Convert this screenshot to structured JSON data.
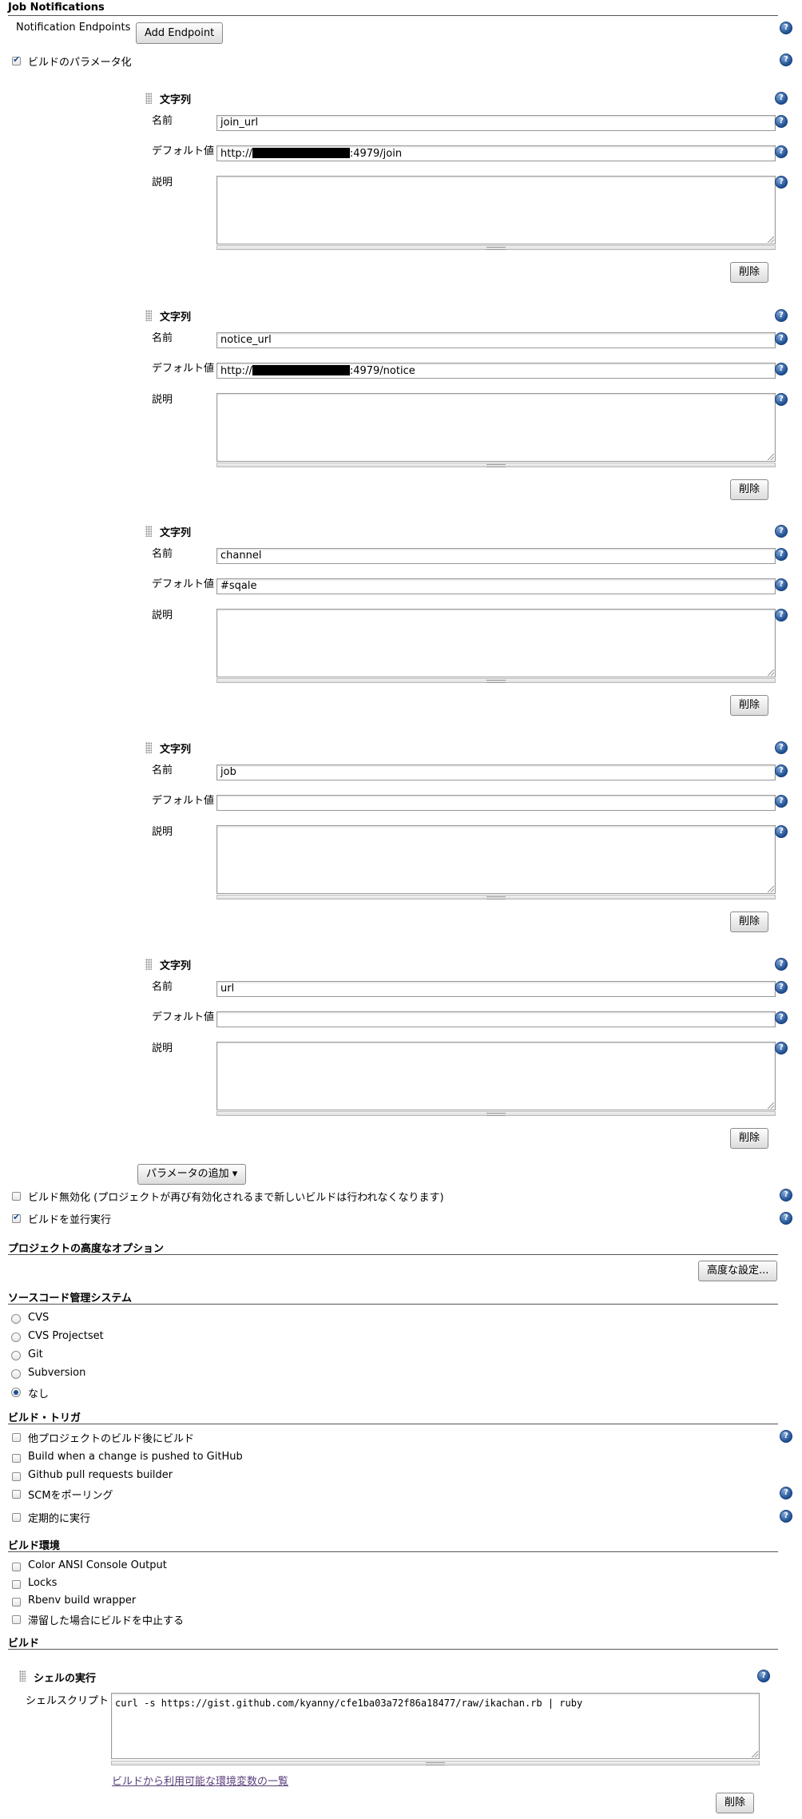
{
  "job_notifications": {
    "title": "Job Notifications",
    "endpoints_label": "Notification Endpoints",
    "add_endpoint": "Add Endpoint"
  },
  "parameterize": {
    "label": "ビルドのパラメータ化",
    "checked": true
  },
  "param_blocks": [
    {
      "type_label": "文字列",
      "name_label": "名前",
      "default_label": "デフォルト値",
      "desc_label": "説明",
      "name_value": "join_url",
      "default_prefix": "http://",
      "default_suffix": ":4979/join",
      "redacted": true,
      "delete_label": "削除"
    },
    {
      "type_label": "文字列",
      "name_label": "名前",
      "default_label": "デフォルト値",
      "desc_label": "説明",
      "name_value": "notice_url",
      "default_prefix": "http://",
      "default_suffix": ":4979/notice",
      "redacted": true,
      "delete_label": "削除"
    },
    {
      "type_label": "文字列",
      "name_label": "名前",
      "default_label": "デフォルト値",
      "desc_label": "説明",
      "name_value": "channel",
      "default_prefix": "#sqale",
      "default_suffix": "",
      "redacted": false,
      "delete_label": "削除"
    },
    {
      "type_label": "文字列",
      "name_label": "名前",
      "default_label": "デフォルト値",
      "desc_label": "説明",
      "name_value": "job",
      "default_prefix": "",
      "default_suffix": "",
      "redacted": false,
      "delete_label": "削除"
    },
    {
      "type_label": "文字列",
      "name_label": "名前",
      "default_label": "デフォルト値",
      "desc_label": "説明",
      "name_value": "url",
      "default_prefix": "",
      "default_suffix": "",
      "redacted": false,
      "delete_label": "削除"
    }
  ],
  "add_param_button": "パラメータの追加 ▾",
  "options": [
    {
      "label": "ビルド無効化 (プロジェクトが再び有効化されるまで新しいビルドは行われなくなります)",
      "checked": false
    },
    {
      "label": "ビルドを並行実行",
      "checked": true
    }
  ],
  "advanced": {
    "title": "プロジェクトの高度なオプション",
    "button": "高度な設定..."
  },
  "scm": {
    "title": "ソースコード管理システム",
    "options": [
      {
        "label": "CVS",
        "selected": false
      },
      {
        "label": "CVS Projectset",
        "selected": false
      },
      {
        "label": "Git",
        "selected": false
      },
      {
        "label": "Subversion",
        "selected": false
      },
      {
        "label": "なし",
        "selected": true
      }
    ]
  },
  "triggers": {
    "title": "ビルド・トリガ",
    "items": [
      {
        "label": "他プロジェクトのビルド後にビルド",
        "checked": false
      },
      {
        "label": "Build when a change is pushed to GitHub",
        "checked": false
      },
      {
        "label": "Github pull requests builder",
        "checked": false
      },
      {
        "label": "SCMをポーリング",
        "checked": false
      },
      {
        "label": "定期的に実行",
        "checked": false
      }
    ]
  },
  "environment": {
    "title": "ビルド環境",
    "items": [
      {
        "label": "Color ANSI Console Output",
        "checked": false
      },
      {
        "label": "Locks",
        "checked": false
      },
      {
        "label": "Rbenv build wrapper",
        "checked": false
      },
      {
        "label": "滞留した場合にビルドを中止する",
        "checked": false
      }
    ]
  },
  "build": {
    "title": "ビルド",
    "step_title": "シェルの実行",
    "script_label": "シェルスクリプト",
    "script_value": "curl -s https://gist.github.com/kyanny/cfe1ba03a72f86a18477/raw/ikachan.rb | ruby",
    "env_link": "ビルドから利用可能な環境変数の一覧",
    "delete_label": "削除"
  }
}
